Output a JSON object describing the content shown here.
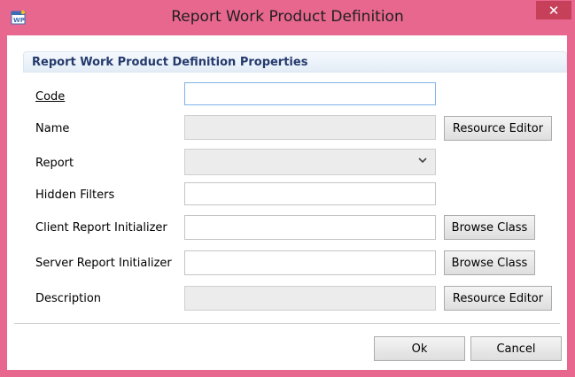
{
  "window": {
    "title": "Report Work Product Definition",
    "close_label": "✕"
  },
  "section": {
    "title": "Report Work Product Definition Properties"
  },
  "fields": {
    "code": {
      "label": "Code",
      "value": ""
    },
    "name": {
      "label": "Name",
      "value": "",
      "button": "Resource Editor"
    },
    "report": {
      "label": "Report",
      "value": ""
    },
    "hidden_filters": {
      "label": "Hidden Filters",
      "value": ""
    },
    "client_initializer": {
      "label": "Client Report Initializer",
      "value": "",
      "button": "Browse Class"
    },
    "server_initializer": {
      "label": "Server Report Initializer",
      "value": "",
      "button": "Browse Class"
    },
    "description": {
      "label": "Description",
      "value": "",
      "button": "Resource Editor"
    }
  },
  "footer": {
    "ok_label": "Ok",
    "cancel_label": "Cancel"
  },
  "colors": {
    "frame": "#e8678f",
    "close_button": "#c7405a",
    "section_title": "#243a6d"
  },
  "icons": {
    "app": "wp-document-icon",
    "close": "close-icon",
    "dropdown": "chevron-down-icon"
  }
}
